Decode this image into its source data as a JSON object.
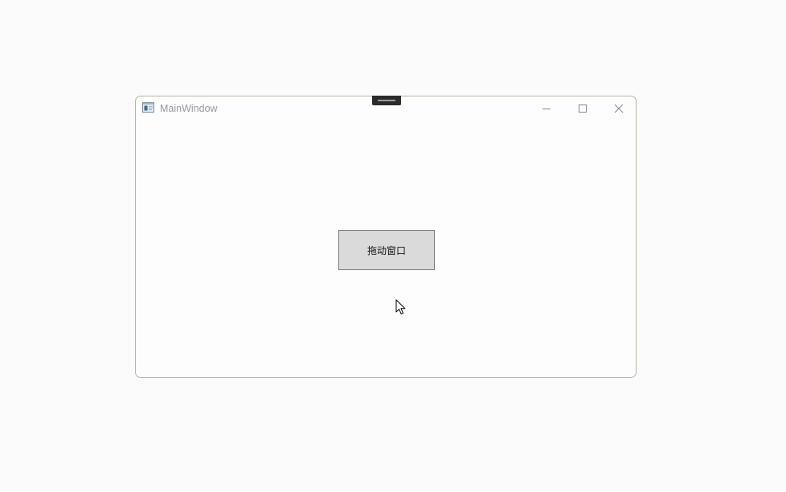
{
  "window": {
    "title": "MainWindow",
    "icons": {
      "app": "app-window-icon",
      "minimize": "minimize-icon",
      "maximize": "maximize-icon",
      "close": "close-icon"
    }
  },
  "main": {
    "drag_button_label": "拖动窗口"
  },
  "colors": {
    "page_background": "#fbfbfb",
    "window_background": "#fdfdfd",
    "button_background": "#dedede",
    "title_text": "#9a9a9a"
  }
}
